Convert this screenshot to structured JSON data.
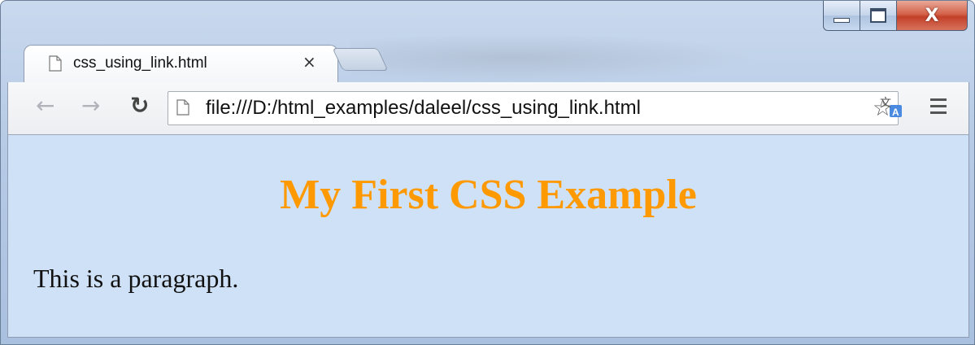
{
  "browser": {
    "tab": {
      "title": "css_using_link.html",
      "close_glyph": "×",
      "icon": "page-icon"
    },
    "toolbar": {
      "back_icon": "back-arrow-icon",
      "forward_icon": "forward-arrow-icon",
      "reload_icon": "reload-icon",
      "address": "file:///D:/html_examples/daleel/css_using_link.html",
      "bookmark_icon": "star-icon",
      "translate_icon": "translate-icon",
      "menu_icon": "hamburger-menu-icon"
    },
    "window_controls": {
      "close_glyph": "X"
    }
  },
  "page": {
    "heading": "My First CSS Example",
    "paragraph": "This is a paragraph.",
    "background_color": "#cfe1f7",
    "heading_color": "#ff9900"
  }
}
